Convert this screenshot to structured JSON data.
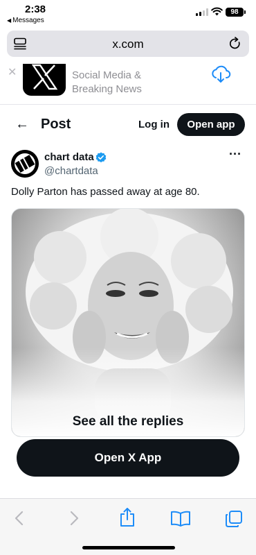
{
  "status_bar": {
    "time": "2:38",
    "back_app": "Messages",
    "battery": "98"
  },
  "browser": {
    "url": "x.com"
  },
  "app_banner": {
    "line1": "Social Media &",
    "line2": "Breaking News"
  },
  "nav": {
    "title": "Post",
    "login_label": "Log in",
    "open_app_label": "Open app"
  },
  "tweet": {
    "author_name": "chart data",
    "author_handle": "@chartdata",
    "text": "Dolly Parton has passed away at age 80.",
    "more_label": "···",
    "media_overlay": "See all the replies"
  },
  "cta": {
    "label": "Open X App"
  },
  "toolbar": {
    "icons": [
      "back-icon",
      "forward-icon",
      "share-icon",
      "bookmarks-icon",
      "tabs-icon"
    ]
  },
  "colors": {
    "brand_dark": "#0f1419",
    "verified_blue": "#1d9bf0",
    "secondary_text": "#536471",
    "link_blue": "#1d8cf8"
  }
}
